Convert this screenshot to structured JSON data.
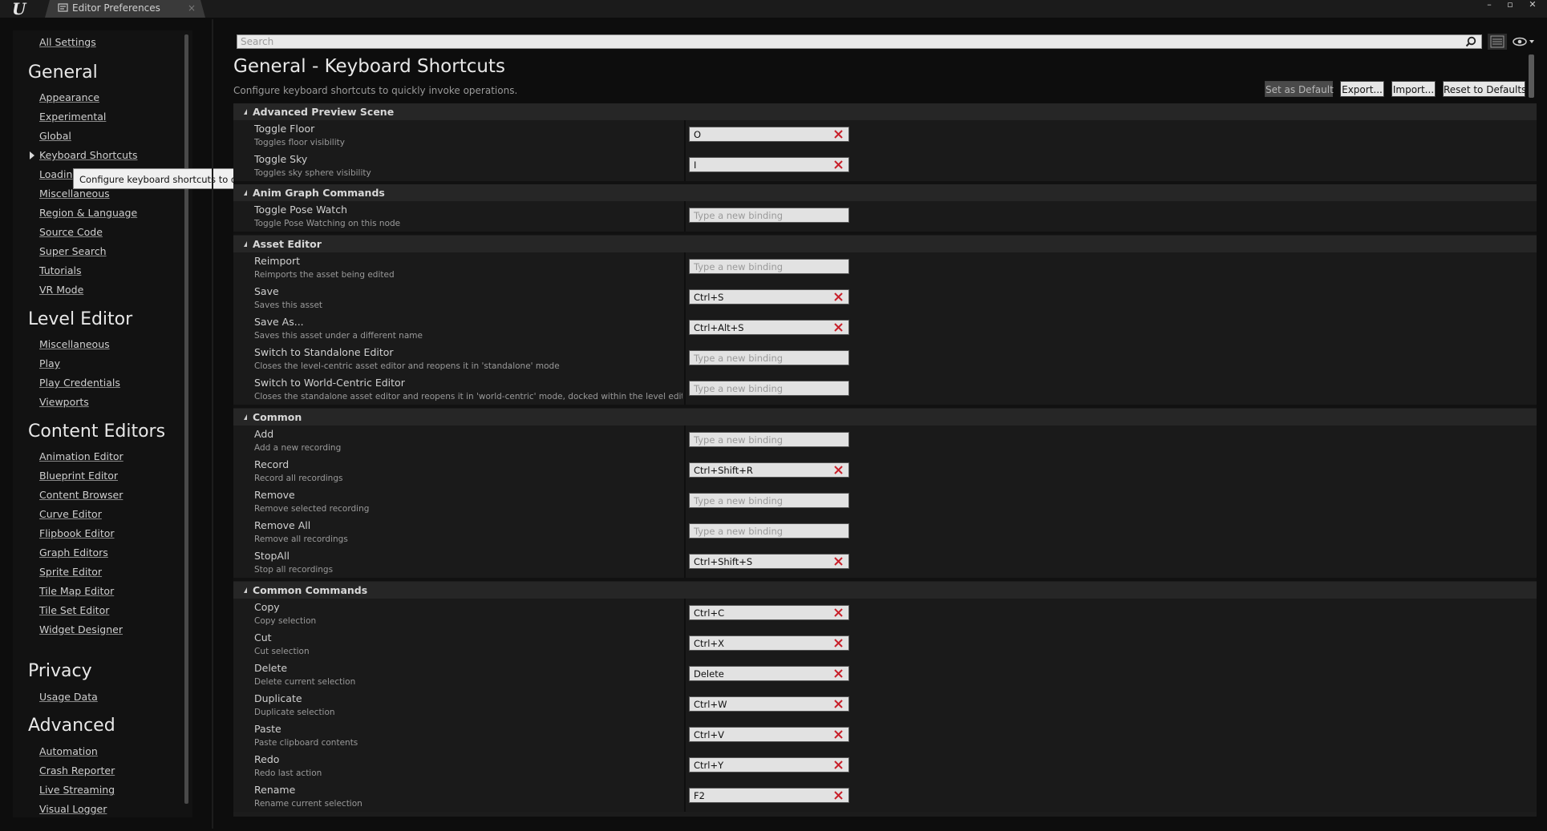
{
  "window": {
    "tab_title": "Editor Preferences",
    "close_glyph": "×",
    "controls": [
      "–",
      "▫",
      "✕"
    ]
  },
  "sidebar": {
    "all_settings": "All Settings",
    "sections": [
      {
        "heading": "General",
        "items": [
          "Appearance",
          "Experimental",
          "Global",
          "Keyboard Shortcuts",
          "Loading",
          "Miscellaneous",
          "Region & Language",
          "Source Code",
          "Super Search",
          "Tutorials",
          "VR Mode"
        ]
      },
      {
        "heading": "Level Editor",
        "items": [
          "Miscellaneous",
          "Play",
          "Play Credentials",
          "Viewports"
        ]
      },
      {
        "heading": "Content Editors",
        "items": [
          "Animation Editor",
          "Blueprint Editor",
          "Content Browser",
          "Curve Editor",
          "Flipbook Editor",
          "Graph Editors",
          "Sprite Editor",
          "Tile Map Editor",
          "Tile Set Editor",
          "Widget Designer"
        ]
      },
      {
        "heading": "Privacy",
        "items": [
          "Usage Data"
        ]
      },
      {
        "heading": "Advanced",
        "items": [
          "Automation",
          "Crash Reporter",
          "Live Streaming",
          "Visual Logger"
        ]
      }
    ],
    "tooltip": "Configure keyboard shortcuts to quickly invoke operations."
  },
  "search": {
    "placeholder": "Search"
  },
  "page": {
    "title": "General - Keyboard Shortcuts",
    "description": "Configure keyboard shortcuts to quickly invoke operations.",
    "buttons": {
      "set_default": "Set as Default",
      "export": "Export...",
      "import": "Import...",
      "reset": "Reset to Defaults"
    }
  },
  "binding_placeholder": "Type a new binding",
  "categories": [
    {
      "name": "Advanced Preview Scene",
      "rows": [
        {
          "name": "Toggle Floor",
          "desc": "Toggles floor visibility",
          "key": "O"
        },
        {
          "name": "Toggle Sky",
          "desc": "Toggles sky sphere visibility",
          "key": "I"
        }
      ]
    },
    {
      "name": "Anim Graph Commands",
      "rows": [
        {
          "name": "Toggle Pose Watch",
          "desc": "Toggle Pose Watching on this node",
          "key": ""
        }
      ]
    },
    {
      "name": "Asset Editor",
      "rows": [
        {
          "name": "Reimport",
          "desc": "Reimports the asset being edited",
          "key": ""
        },
        {
          "name": "Save",
          "desc": "Saves this asset",
          "key": "Ctrl+S"
        },
        {
          "name": "Save As...",
          "desc": "Saves this asset under a different name",
          "key": "Ctrl+Alt+S"
        },
        {
          "name": "Switch to Standalone Editor",
          "desc": "Closes the level-centric asset editor and reopens it in 'standalone' mode",
          "key": ""
        },
        {
          "name": "Switch to World-Centric Editor",
          "desc": "Closes the standalone asset editor and reopens it in 'world-centric' mode, docked within the level editor tha",
          "key": ""
        }
      ]
    },
    {
      "name": "Common",
      "rows": [
        {
          "name": "Add",
          "desc": "Add a new recording",
          "key": ""
        },
        {
          "name": "Record",
          "desc": "Record all recordings",
          "key": "Ctrl+Shift+R"
        },
        {
          "name": "Remove",
          "desc": "Remove selected recording",
          "key": ""
        },
        {
          "name": "Remove All",
          "desc": "Remove all recordings",
          "key": ""
        },
        {
          "name": "StopAll",
          "desc": "Stop all recordings",
          "key": "Ctrl+Shift+S"
        }
      ]
    },
    {
      "name": "Common Commands",
      "rows": [
        {
          "name": "Copy",
          "desc": "Copy selection",
          "key": "Ctrl+C"
        },
        {
          "name": "Cut",
          "desc": "Cut selection",
          "key": "Ctrl+X"
        },
        {
          "name": "Delete",
          "desc": "Delete current selection",
          "key": "Delete"
        },
        {
          "name": "Duplicate",
          "desc": "Duplicate selection",
          "key": "Ctrl+W"
        },
        {
          "name": "Paste",
          "desc": "Paste clipboard contents",
          "key": "Ctrl+V"
        },
        {
          "name": "Redo",
          "desc": "Redo last action",
          "key": "Ctrl+Y"
        },
        {
          "name": "Rename",
          "desc": "Rename current selection",
          "key": "F2"
        }
      ]
    }
  ]
}
